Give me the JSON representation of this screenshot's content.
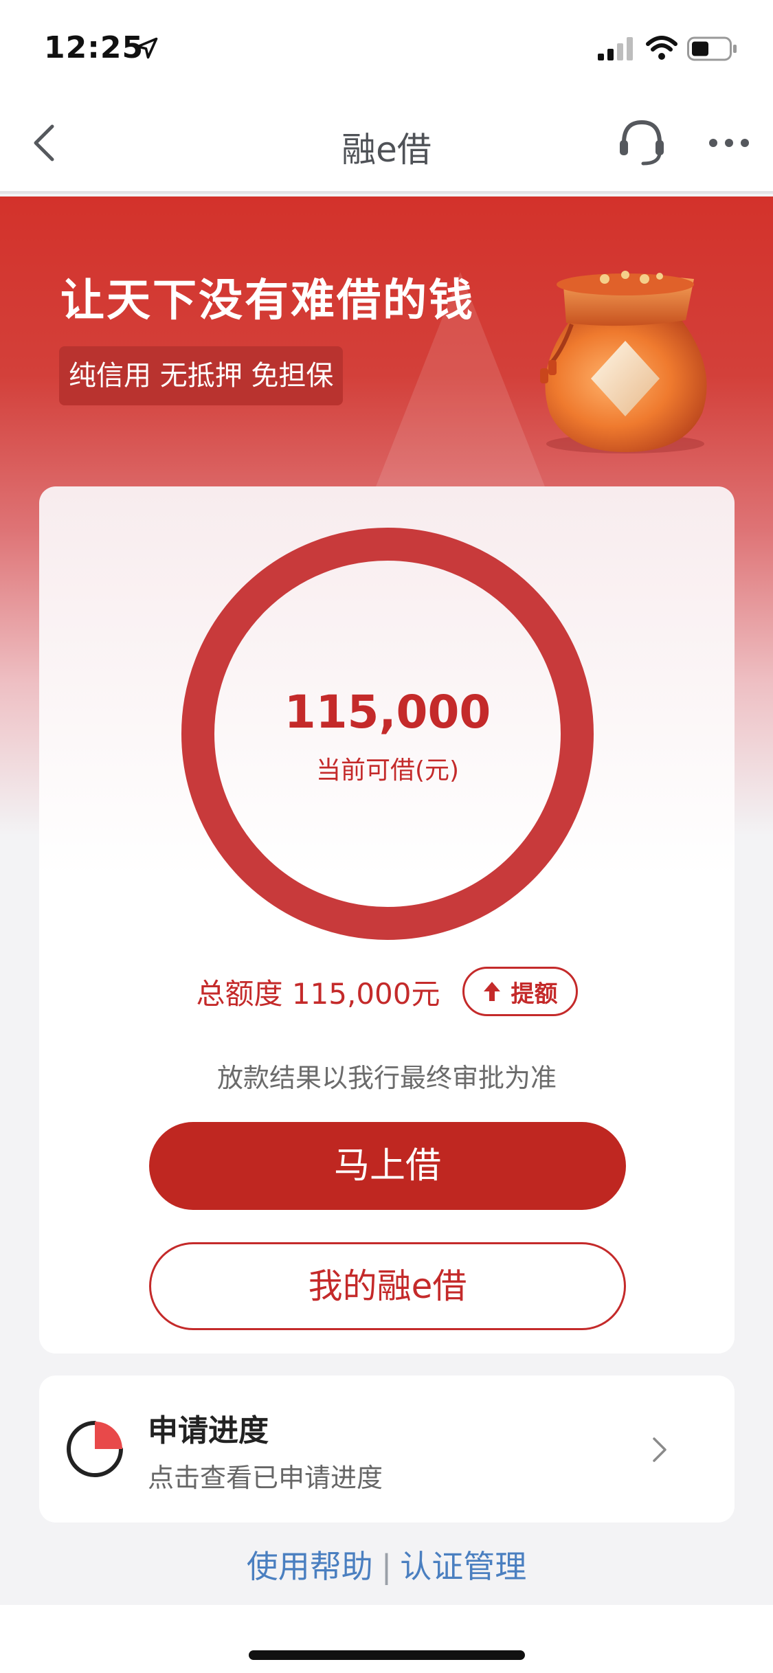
{
  "status_bar": {
    "time": "12:25"
  },
  "nav": {
    "title": "融e借"
  },
  "hero": {
    "title": "让天下没有难借的钱",
    "badge": "纯信用 无抵押 免担保"
  },
  "credit": {
    "available_amount": "115,000",
    "available_label": "当前可借(元)",
    "total_label": "总额度 115,000元",
    "raise_label": "提额",
    "disclaimer": "放款结果以我行最终审批为准"
  },
  "actions": {
    "borrow_now": "马上借",
    "my_loan": "我的融e借"
  },
  "progress": {
    "title": "申请进度",
    "subtitle": "点击查看已申请进度"
  },
  "footer": {
    "help": "使用帮助",
    "separator": "|",
    "auth": "认证管理"
  },
  "colors": {
    "brand_red": "#c42a2a",
    "button_red": "#bf2721",
    "link_blue": "#4a7fc0"
  },
  "icons": [
    "location-arrow-icon",
    "signal-icon",
    "wifi-icon",
    "battery-icon",
    "back-icon",
    "headset-icon",
    "more-icon",
    "money-bag-icon",
    "up-arrow-icon",
    "progress-pie-icon",
    "chevron-right-icon"
  ]
}
